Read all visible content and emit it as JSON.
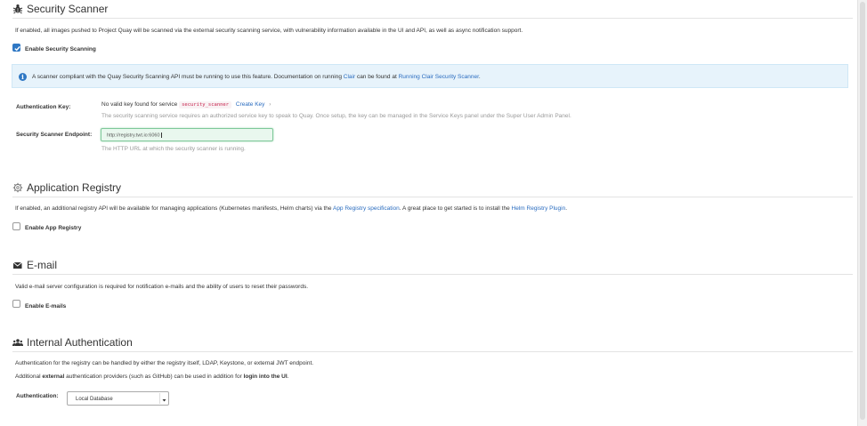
{
  "security_scanner": {
    "title": "Security Scanner",
    "icon": "bug-icon",
    "description": "If enabled, all images pushed to Project Quay will be scanned via the external security scanning service, with vulnerability information available in the UI and API, as well as async notification support.",
    "enable_label": "Enable Security Scanning",
    "enabled": true,
    "info": {
      "prefix": "A scanner compliant with the Quay Security Scanning API must be running to use this feature. Documentation on running ",
      "clair_link": "Clair",
      "middle": " can be found at ",
      "running_link": "Running Clair Security Scanner",
      "suffix": "."
    },
    "auth_key": {
      "label": "Authentication Key:",
      "status_prefix": "No valid key found for service",
      "service_name": "security_scanner",
      "create_link": "Create Key",
      "create_chevron": "›",
      "help": "The security scanning service requires an authorized service key to speak to Quay. Once setup, the key can be managed in the Service Keys panel under the Super User Admin Panel."
    },
    "endpoint": {
      "label": "Security Scanner Endpoint:",
      "value": "http://registry.twt.io:6060",
      "help": "The HTTP URL at which the security scanner is running."
    }
  },
  "app_registry": {
    "title": "Application Registry",
    "icon": "gear-icon",
    "description_prefix": "If enabled, an additional registry API will be available for managing applications (Kubernetes manifests, Helm charts) via the ",
    "spec_link": "App Registry specification",
    "description_middle": ". A great place to get started is to install the ",
    "helm_link": "Helm Registry Plugin",
    "description_suffix": ".",
    "enable_label": "Enable App Registry",
    "enabled": false
  },
  "email": {
    "title": "E-mail",
    "icon": "envelope-icon",
    "description": "Valid e-mail server configuration is required for notification e-mails and the ability of users to reset their passwords.",
    "enable_label": "Enable E-mails",
    "enabled": false
  },
  "internal_auth": {
    "title": "Internal Authentication",
    "icon": "users-icon",
    "description1": "Authentication for the registry can be handled by either the registry itself, LDAP, Keystone, or external JWT endpoint.",
    "desc2_prefix": "Additional ",
    "desc2_bold1": "external",
    "desc2_middle": " authentication providers (such as GitHub) can be used in addition for ",
    "desc2_bold2": "login into the UI",
    "desc2_suffix": ".",
    "auth_label": "Authentication:",
    "auth_value": "Local Database"
  },
  "colors": {
    "link": "#2a6cbf",
    "accent": "#2f78c4",
    "info_bg": "#e7f3fb",
    "code_text": "#c7254e",
    "input_bg": "#e9f7ee"
  }
}
